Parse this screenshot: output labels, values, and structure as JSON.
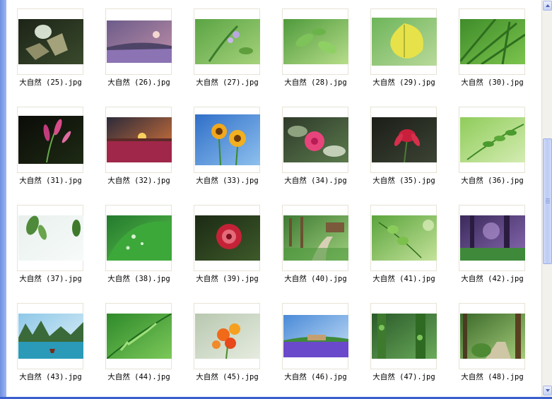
{
  "files": [
    {
      "caption": "大自然 (25).jpg",
      "icon": "image-moth-dark"
    },
    {
      "caption": "大自然 (26).jpg",
      "icon": "image-lavender-dusk"
    },
    {
      "caption": "大自然 (27).jpg",
      "icon": "image-green-sprig"
    },
    {
      "caption": "大自然 (28).jpg",
      "icon": "image-green-leaves"
    },
    {
      "caption": "大自然 (29).jpg",
      "icon": "image-yellow-leaf"
    },
    {
      "caption": "大自然 (30).jpg",
      "icon": "image-grass-blades"
    },
    {
      "caption": "大自然 (31).jpg",
      "icon": "image-pink-buds"
    },
    {
      "caption": "大自然 (32).jpg",
      "icon": "image-tulip-sunset"
    },
    {
      "caption": "大自然 (33).jpg",
      "icon": "image-sunflowers"
    },
    {
      "caption": "大自然 (34).jpg",
      "icon": "image-pink-camellia"
    },
    {
      "caption": "大自然 (35).jpg",
      "icon": "image-red-orchid"
    },
    {
      "caption": "大自然 (36).jpg",
      "icon": "image-fern-light"
    },
    {
      "caption": "大自然 (37).jpg",
      "icon": "image-leaves-white"
    },
    {
      "caption": "大自然 (38).jpg",
      "icon": "image-leaf-drops"
    },
    {
      "caption": "大自然 (39).jpg",
      "icon": "image-red-chrysanthemum"
    },
    {
      "caption": "大自然 (40).jpg",
      "icon": "image-garden-path"
    },
    {
      "caption": "大自然 (41).jpg",
      "icon": "image-bokeh-leaves"
    },
    {
      "caption": "大自然 (42).jpg",
      "icon": "image-purple-forest"
    },
    {
      "caption": "大自然 (43).jpg",
      "icon": "image-karst-bay"
    },
    {
      "caption": "大自然 (44).jpg",
      "icon": "image-fern-frond"
    },
    {
      "caption": "大自然 (45).jpg",
      "icon": "image-orange-flowers"
    },
    {
      "caption": "大自然 (46).jpg",
      "icon": "image-lavender-field"
    },
    {
      "caption": "大自然 (47).jpg",
      "icon": "image-ivy-trees"
    },
    {
      "caption": "大自然 (48).jpg",
      "icon": "image-forest-steps"
    }
  ],
  "colors": {
    "left_pane": "#7d98e6",
    "caption_text": "#000000",
    "frame_border": "#e7e3d6",
    "scrollbar_track": "#f3f1ec",
    "scrollbar_thumb": "#c6d3f7",
    "taskbar": "#3a5fcd"
  }
}
